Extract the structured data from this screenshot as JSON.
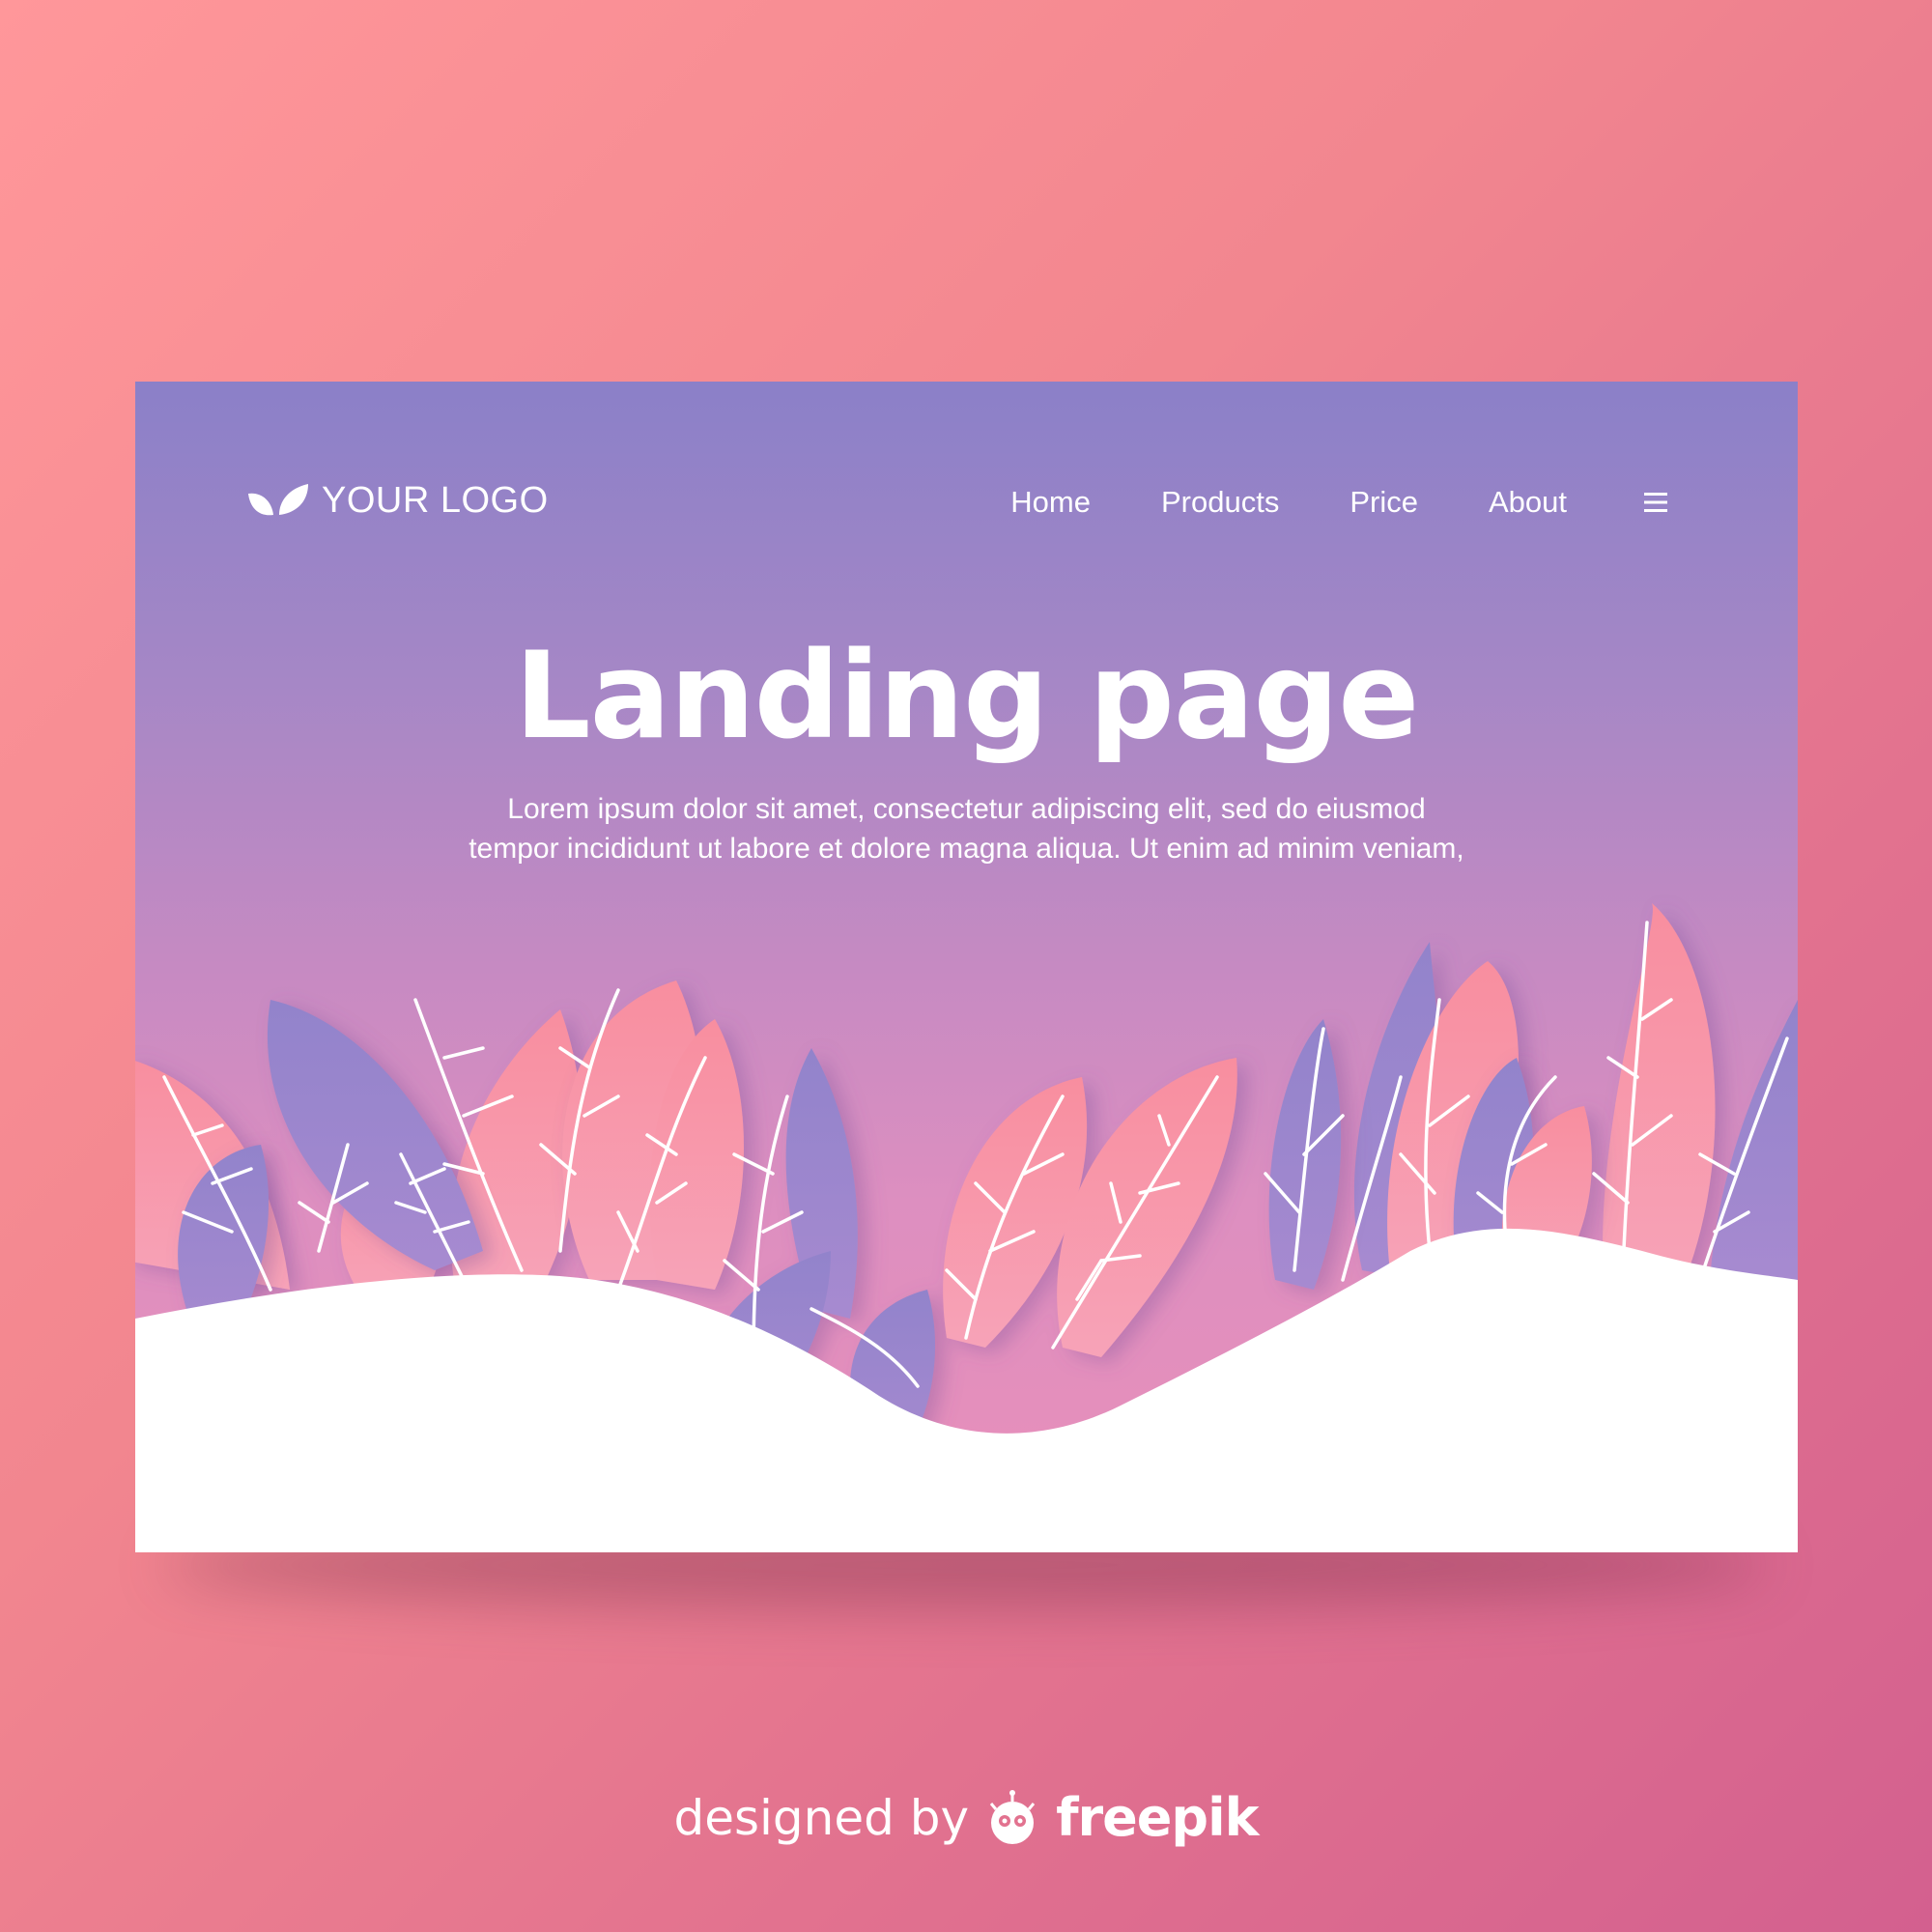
{
  "header": {
    "logo_text": "YOUR LOGO",
    "nav": [
      "Home",
      "Products",
      "Price",
      "About"
    ],
    "menu_icon": "hamburger-icon"
  },
  "hero": {
    "title": "Landing page",
    "body": "Lorem ipsum dolor sit amet, consectetur adipiscing elit, sed do eiusmod tempor incididunt ut labore et dolore magna aliqua. Ut enim ad minim veniam,"
  },
  "credit": {
    "by": "designed by",
    "brand": "freepik"
  },
  "colors": {
    "background_light": "#ff979a",
    "background_dark": "#d3608f",
    "card_top": "#8b80c8",
    "card_bottom": "#e98fb9",
    "leaf_pink": "#f58ea3",
    "leaf_purple": "#9b86cc",
    "ground": "#ffffff"
  }
}
